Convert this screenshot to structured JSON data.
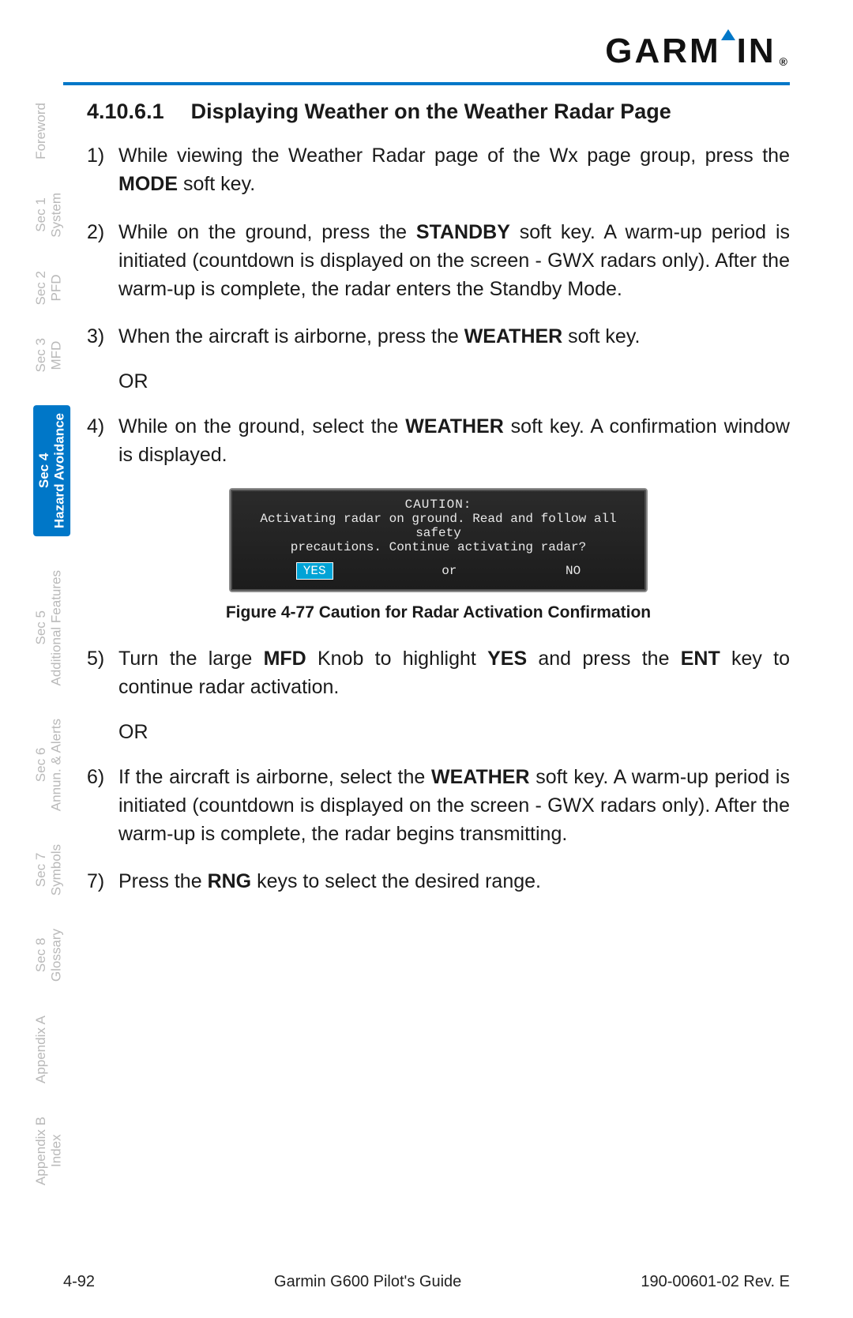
{
  "brand": {
    "name": "GARMIN",
    "reg": "®"
  },
  "heading": {
    "number": "4.10.6.1",
    "title": "Displaying Weather on the Weather Radar Page"
  },
  "tabs": [
    {
      "l1": "",
      "l2": "Foreword",
      "active": false
    },
    {
      "l1": "Sec 1",
      "l2": "System",
      "active": false
    },
    {
      "l1": "Sec 2",
      "l2": "PFD",
      "active": false
    },
    {
      "l1": "Sec 3",
      "l2": "MFD",
      "active": false
    },
    {
      "l1": "Sec 4",
      "l2": "Hazard Avoidance",
      "active": true
    },
    {
      "l1": "Sec 5",
      "l2": "Additional Features",
      "active": false
    },
    {
      "l1": "Sec 6",
      "l2": "Annun. & Alerts",
      "active": false
    },
    {
      "l1": "Sec 7",
      "l2": "Symbols",
      "active": false
    },
    {
      "l1": "Sec 8",
      "l2": "Glossary",
      "active": false
    },
    {
      "l1": "",
      "l2": "Appendix A",
      "active": false
    },
    {
      "l1": "Appendix B",
      "l2": "Index",
      "active": false
    }
  ],
  "steps": {
    "s1": {
      "n": "1)",
      "pre": "While viewing the Weather Radar page of the Wx page group, press the ",
      "b": "MODE",
      "post": " soft key."
    },
    "s2": {
      "n": "2)",
      "pre": " While on the ground, press the ",
      "b": "STANDBY",
      "post": " soft key. A warm-up period is initiated (countdown is displayed on the screen - GWX radars only). After the warm-up is complete, the radar enters the Standby Mode."
    },
    "s3": {
      "n": "3)",
      "pre": "When the aircraft is airborne, press the ",
      "b": "WEATHER",
      "post": " soft key."
    },
    "or1": "OR",
    "s4": {
      "n": "4)",
      "pre": "While on the ground, select the ",
      "b": "WEATHER",
      "post": " soft key. A confirmation window is displayed."
    },
    "s5": {
      "n": "5)",
      "pre": "Turn the large ",
      "b1": "MFD",
      "mid1": " Knob to highlight ",
      "b2": "YES",
      "mid2": " and press the ",
      "b3": "ENT",
      "post": " key to continue radar activation."
    },
    "or2": "OR",
    "s6": {
      "n": "6)",
      "pre": "If the aircraft is airborne, select the ",
      "b": "WEATHER",
      "post": " soft key. A warm-up period is initiated (countdown is displayed on the screen - GWX radars only).  After the warm-up is complete, the radar begins transmitting."
    },
    "s7": {
      "n": "7)",
      "pre": "Press the ",
      "b": "RNG",
      "post": " keys to select the desired range."
    }
  },
  "caution": {
    "title": "CAUTION:",
    "line1": "Activating radar on ground.  Read and follow all safety",
    "line2": "precautions.  Continue activating radar?",
    "yes": "YES",
    "or": "or",
    "no": "NO"
  },
  "figure_caption": "Figure 4-77  Caution for Radar Activation Confirmation",
  "footer": {
    "page": "4-92",
    "title": "Garmin G600 Pilot's Guide",
    "doc": "190-00601-02  Rev. E"
  }
}
